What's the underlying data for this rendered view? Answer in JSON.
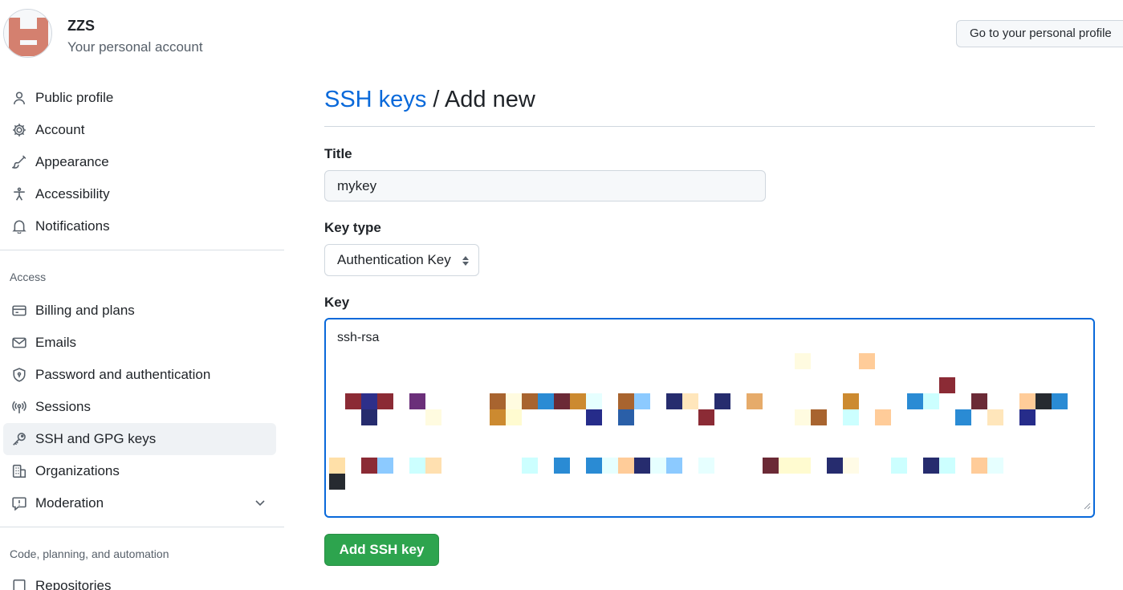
{
  "account": {
    "name": "ZZS",
    "subtitle": "Your personal account",
    "profile_button": "Go to your personal profile"
  },
  "sidebar": {
    "items": [
      {
        "label": "Public profile",
        "icon": "person-icon"
      },
      {
        "label": "Account",
        "icon": "gear-icon"
      },
      {
        "label": "Appearance",
        "icon": "paintbrush-icon"
      },
      {
        "label": "Accessibility",
        "icon": "accessibility-icon"
      },
      {
        "label": "Notifications",
        "icon": "bell-icon"
      }
    ],
    "access_title": "Access",
    "access_items": [
      {
        "label": "Billing and plans",
        "icon": "credit-card-icon"
      },
      {
        "label": "Emails",
        "icon": "mail-icon"
      },
      {
        "label": "Password and authentication",
        "icon": "shield-lock-icon"
      },
      {
        "label": "Sessions",
        "icon": "broadcast-icon"
      },
      {
        "label": "SSH and GPG keys",
        "icon": "key-icon",
        "active": true
      },
      {
        "label": "Organizations",
        "icon": "organization-icon"
      },
      {
        "label": "Moderation",
        "icon": "report-icon",
        "expandable": true
      }
    ],
    "code_title": "Code, planning, and automation",
    "code_items": [
      {
        "label": "Repositories",
        "icon": "repo-icon"
      }
    ]
  },
  "main": {
    "breadcrumb_link": "SSH keys",
    "breadcrumb_sep": " / ",
    "breadcrumb_current": "Add new",
    "title_label": "Title",
    "title_value": "mykey",
    "key_type_label": "Key type",
    "key_type_value": "Authentication Key",
    "key_label": "Key",
    "key_value_prefix": "ssh-rsa",
    "submit_label": "Add SSH key"
  },
  "colors": {
    "link": "#0969da",
    "primary_button": "#2da44e",
    "focus_border": "#0969da",
    "avatar": "#d4806f"
  }
}
